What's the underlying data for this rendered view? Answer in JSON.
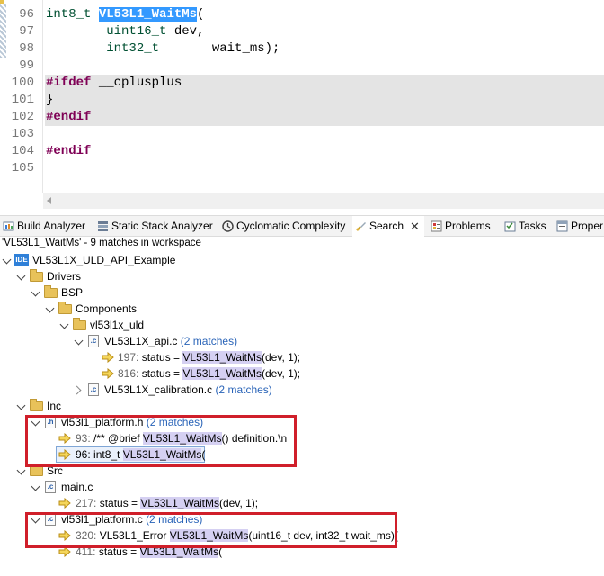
{
  "editor": {
    "lines": [
      {
        "num": "96",
        "parts": [
          {
            "t": "int8_t",
            "c": "ty"
          },
          {
            "t": " "
          },
          {
            "t": "VL53L1_WaitMs",
            "c": "sel"
          },
          {
            "t": "("
          }
        ]
      },
      {
        "num": "97",
        "parts": [
          {
            "t": "        "
          },
          {
            "t": "uint16_t",
            "c": "ty"
          },
          {
            "t": " dev,"
          }
        ]
      },
      {
        "num": "98",
        "parts": [
          {
            "t": "        "
          },
          {
            "t": "int32_t",
            "c": "ty"
          },
          {
            "t": "       wait_ms);"
          }
        ]
      },
      {
        "num": "99",
        "parts": []
      },
      {
        "num": "100",
        "parts": [
          {
            "t": "#ifdef",
            "c": "preproc"
          },
          {
            "t": " __cplusplus"
          }
        ],
        "shaded": true
      },
      {
        "num": "101",
        "parts": [
          {
            "t": "}"
          }
        ],
        "shaded": true
      },
      {
        "num": "102",
        "parts": [
          {
            "t": "#endif",
            "c": "preproc"
          }
        ],
        "shaded": true
      },
      {
        "num": "103",
        "parts": []
      },
      {
        "num": "104",
        "parts": [
          {
            "t": "#endif",
            "c": "preproc"
          }
        ]
      },
      {
        "num": "105",
        "parts": []
      }
    ]
  },
  "tabs": [
    {
      "label": "Build Analyzer",
      "icon": "build-analyzer-icon"
    },
    {
      "label": "Static Stack Analyzer",
      "icon": "stack-analyzer-icon"
    },
    {
      "label": "Cyclomatic Complexity",
      "icon": "complexity-icon"
    },
    {
      "label": "Search",
      "icon": "search-icon",
      "active": true
    },
    {
      "label": "Problems",
      "icon": "problems-icon"
    },
    {
      "label": "Tasks",
      "icon": "tasks-icon"
    },
    {
      "label": "Proper",
      "icon": "properties-icon"
    }
  ],
  "search": {
    "summary": "'VL53L1_WaitMs' - 9 matches in workspace",
    "tree": {
      "project": "VL53L1X_ULD_API_Example",
      "drivers": "Drivers",
      "bsp": "BSP",
      "components": "Components",
      "uld": "vl53l1x_uld",
      "api_file": "VL53L1X_api.c",
      "api_count": "(2 matches)",
      "api_m1_line": "197:",
      "api_m1_pre": "status = ",
      "api_m1_hit": "VL53L1_WaitMs",
      "api_m1_post": "(dev, 1);",
      "api_m2_line": "816:",
      "api_m2_pre": "status = ",
      "api_m2_hit": "VL53L1_WaitMs",
      "api_m2_post": "(dev, 1);",
      "calib_file": "VL53L1X_calibration.c",
      "calib_count": "(2 matches)",
      "inc": "Inc",
      "plat_h": "vl53l1_platform.h",
      "plat_h_count": "(2 matches)",
      "h_m1_line": "93:",
      "h_m1_pre": "/** @brief ",
      "h_m1_hit": "VL53L1_WaitMs",
      "h_m1_post": "() definition.\\n",
      "h_m2_line": "96:",
      "h_m2_pre": "int8_t ",
      "h_m2_hit": "VL53L1_WaitMs",
      "h_m2_post": "(",
      "src": "Src",
      "main_c": "main.c",
      "main_m1_line": "217:",
      "main_m1_pre": "status = ",
      "main_m1_hit": "VL53L1_WaitMs",
      "main_m1_post": "(dev, 1);",
      "plat_c": "vl53l1_platform.c",
      "plat_c_count": "(2 matches)",
      "c_m1_line": "320:",
      "c_m1_pre": "VL53L1_Error ",
      "c_m1_hit": "VL53L1_WaitMs",
      "c_m1_post": "(uint16_t dev, int32_t wait_ms){",
      "c_m2_line": "411:",
      "c_m2_pre": "status = ",
      "c_m2_hit": "VL53L1_WaitMs",
      "c_m2_post": "("
    }
  },
  "colors": {
    "selection": "#3399ff",
    "match_highlight": "#d5d0f2",
    "annotation_red": "#d01f2a",
    "count_blue": "#2a64b8"
  }
}
